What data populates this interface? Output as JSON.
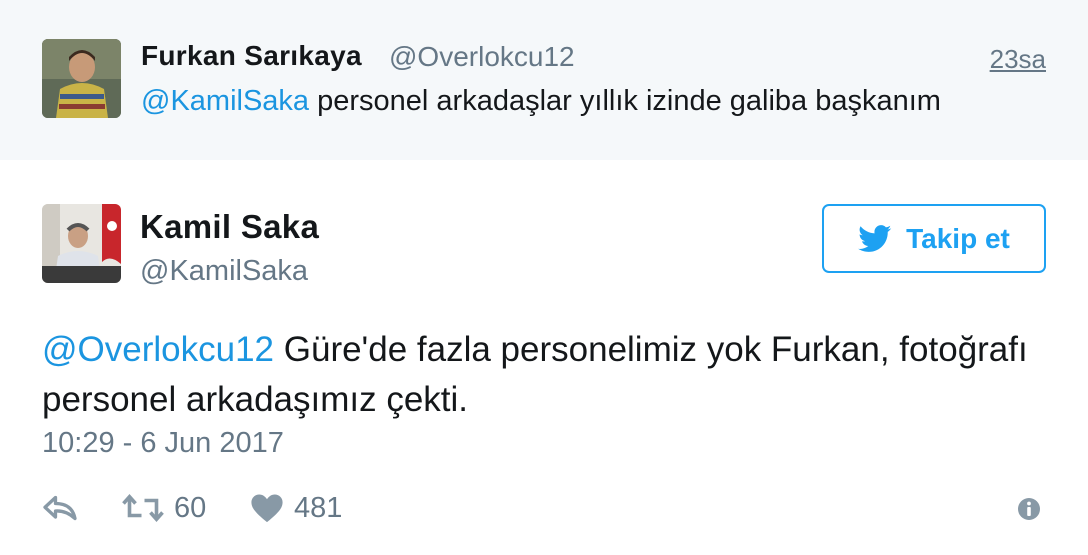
{
  "reply_tweet": {
    "display_name": "Furkan Sarıkaya",
    "handle": "@Overlokcu12",
    "time": "23sa",
    "mention": "@KamilSaka",
    "text": "personel arkadaşlar yıllık izinde galiba başkanım"
  },
  "main_tweet": {
    "display_name": "Kamil Saka",
    "handle": "@KamilSaka",
    "follow_label": "Takip et",
    "mention": "@Overlokcu12",
    "text": "Güre'de fazla personelimiz yok Furkan, fotoğrafı personel arkadaşımız çekti.",
    "date": "10:29 - 6 Jun 2017",
    "retweet_count": "60",
    "like_count": "481"
  },
  "icons": {
    "reply": "reply-icon",
    "retweet": "retweet-icon",
    "like": "heart-icon",
    "more": "info-icon",
    "bird": "twitter-bird-icon"
  },
  "colors": {
    "link": "#1b95e0",
    "brand": "#1da1f2",
    "muted": "#657786",
    "reply_background": "#f5f8fa"
  }
}
